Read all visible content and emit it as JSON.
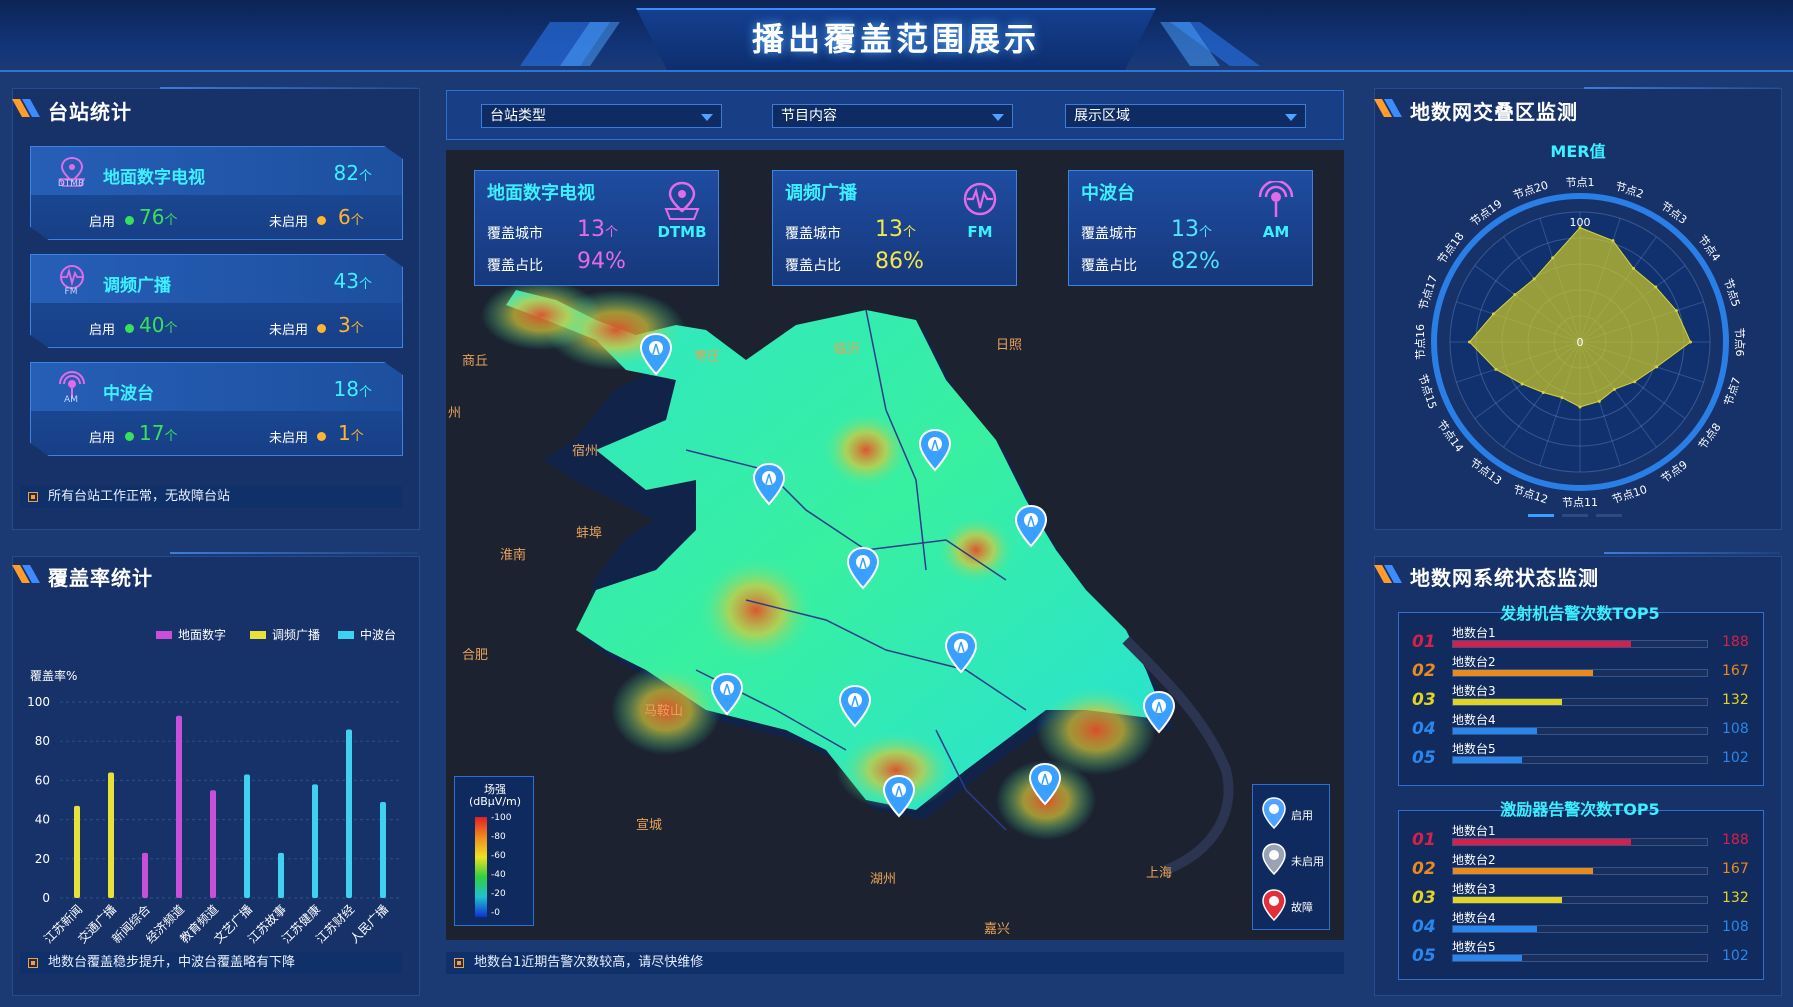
{
  "header": {
    "title": "播出覆盖范围展示"
  },
  "station_stats": {
    "title": "台站统计",
    "cards": [
      {
        "name": "地面数字电视",
        "icon": "dtmb-icon",
        "icon_label": "DTMB",
        "total": "82",
        "on_label": "启用",
        "on": "76",
        "off_label": "未启用",
        "off": "6"
      },
      {
        "name": "调频广播",
        "icon": "fm-icon",
        "icon_label": "FM",
        "total": "43",
        "on_label": "启用",
        "on": "40",
        "off_label": "未启用",
        "off": "3"
      },
      {
        "name": "中波台",
        "icon": "am-icon",
        "icon_label": "AM",
        "total": "18",
        "on_label": "启用",
        "on": "17",
        "off_label": "未启用",
        "off": "1"
      }
    ],
    "unit": "个",
    "note": "所有台站工作正常，无故障台站"
  },
  "coverage_stats": {
    "title": "覆盖率统计",
    "note": "地数台覆盖稳步提升，中波台覆盖略有下降"
  },
  "chart_data": {
    "type": "bar",
    "ylabel": "覆盖率%",
    "ylim": [
      0,
      100
    ],
    "yticks": [
      "0",
      "20",
      "40",
      "60",
      "80",
      "100"
    ],
    "categories": [
      "江苏新闻",
      "交通广播",
      "新闻综合",
      "经济频道",
      "教育频道",
      "文艺广播",
      "江苏故事",
      "江苏健康",
      "江苏财经",
      "人民广播"
    ],
    "series": [
      {
        "name": "地面数字",
        "color": "#c84fd8"
      },
      {
        "name": "调频广播",
        "color": "#e6e23a"
      },
      {
        "name": "中波台",
        "color": "#3fd2f0"
      }
    ],
    "bars": [
      {
        "category": "江苏新闻",
        "series": "调频广播",
        "value": 47
      },
      {
        "category": "交通广播",
        "series": "调频广播",
        "value": 64
      },
      {
        "category": "新闻综合",
        "series": "地面数字",
        "value": 23
      },
      {
        "category": "经济频道",
        "series": "地面数字",
        "value": 93
      },
      {
        "category": "教育频道",
        "series": "地面数字",
        "value": 55
      },
      {
        "category": "文艺广播",
        "series": "中波台",
        "value": 63
      },
      {
        "category": "江苏故事",
        "series": "中波台",
        "value": 23
      },
      {
        "category": "江苏健康",
        "series": "中波台",
        "value": 58
      },
      {
        "category": "江苏财经",
        "series": "中波台",
        "value": 86
      },
      {
        "category": "人民广播",
        "series": "中波台",
        "value": 49
      }
    ]
  },
  "filters": [
    {
      "label": "台站类型"
    },
    {
      "label": "节目内容"
    },
    {
      "label": "展示区域"
    }
  ],
  "coverage_cards": [
    {
      "name": "地面数字电视",
      "icon": "dtmb-pin-icon",
      "icon_label": "DTMB",
      "city_label": "覆盖城市",
      "cities": "13",
      "ratio_label": "覆盖占比",
      "ratio": "94%",
      "value_color": "#e36be8"
    },
    {
      "name": "调频广播",
      "icon": "fm-wave-icon",
      "icon_label": "FM",
      "city_label": "覆盖城市",
      "cities": "13",
      "ratio_label": "覆盖占比",
      "ratio": "86%",
      "value_color": "#f3e84b"
    },
    {
      "name": "中波台",
      "icon": "am-antenna-icon",
      "icon_label": "AM",
      "city_label": "覆盖城市",
      "cities": "13",
      "ratio_label": "覆盖占比",
      "ratio": "82%",
      "value_color": "#52e4ff"
    }
  ],
  "map": {
    "cities": [
      "商丘",
      "枣庄",
      "临沂",
      "日照",
      "宿州",
      "蚌埠",
      "淮南",
      "合肥",
      "马鞍山",
      "宣城",
      "湖州",
      "嘉兴",
      "上海",
      "州"
    ],
    "legend_title": "场强",
    "legend_unit": "(dBμV/m)",
    "legend_ticks": [
      "-100",
      "-80",
      "-60",
      "-40",
      "-20",
      "-0"
    ],
    "status_legend": [
      {
        "label": "启用",
        "color": "#4da3ff"
      },
      {
        "label": "未启用",
        "color": "#9aa3b5"
      },
      {
        "label": "故障",
        "color": "#e0303a"
      }
    ],
    "note": "地数台1近期告警次数较高，请尽快维修"
  },
  "overlap": {
    "title": "地数网交叠区监测",
    "radar_title": "MER值",
    "radar_max": "100",
    "radar_center": "0",
    "nodes": [
      "节点1",
      "节点2",
      "节点3",
      "节点4",
      "节点5",
      "节点6",
      "节点7",
      "节点8",
      "节点9",
      "节点10",
      "节点11",
      "节点12",
      "节点13",
      "节点14",
      "节点15",
      "节点16",
      "节点17",
      "节点18",
      "节点19",
      "节点20"
    ],
    "values": [
      88,
      82,
      70,
      72,
      78,
      85,
      62,
      52,
      45,
      48,
      50,
      45,
      48,
      55,
      68,
      85,
      70,
      62,
      60,
      68
    ]
  },
  "system_status": {
    "title": "地数网系统状态监测",
    "transmitter": {
      "title": "发射机告警次数TOP5",
      "items": [
        {
          "rank": "01",
          "name": "地数台1",
          "value": "188",
          "fraction": 0.7,
          "color": "#d6204a"
        },
        {
          "rank": "02",
          "name": "地数台2",
          "value": "167",
          "fraction": 0.55,
          "color": "#e88a1e"
        },
        {
          "rank": "03",
          "name": "地数台3",
          "value": "132",
          "fraction": 0.43,
          "color": "#e3d420"
        },
        {
          "rank": "04",
          "name": "地数台4",
          "value": "108",
          "fraction": 0.33,
          "color": "#2a86ea"
        },
        {
          "rank": "05",
          "name": "地数台5",
          "value": "102",
          "fraction": 0.27,
          "color": "#2a86ea"
        }
      ]
    },
    "exciter": {
      "title": "激励器告警次数TOP5",
      "items": [
        {
          "rank": "01",
          "name": "地数台1",
          "value": "188",
          "fraction": 0.7,
          "color": "#d6204a"
        },
        {
          "rank": "02",
          "name": "地数台2",
          "value": "167",
          "fraction": 0.55,
          "color": "#e88a1e"
        },
        {
          "rank": "03",
          "name": "地数台3",
          "value": "132",
          "fraction": 0.43,
          "color": "#e3d420"
        },
        {
          "rank": "04",
          "name": "地数台4",
          "value": "108",
          "fraction": 0.33,
          "color": "#2a86ea"
        },
        {
          "rank": "05",
          "name": "地数台5",
          "value": "102",
          "fraction": 0.27,
          "color": "#2a86ea"
        }
      ]
    }
  }
}
